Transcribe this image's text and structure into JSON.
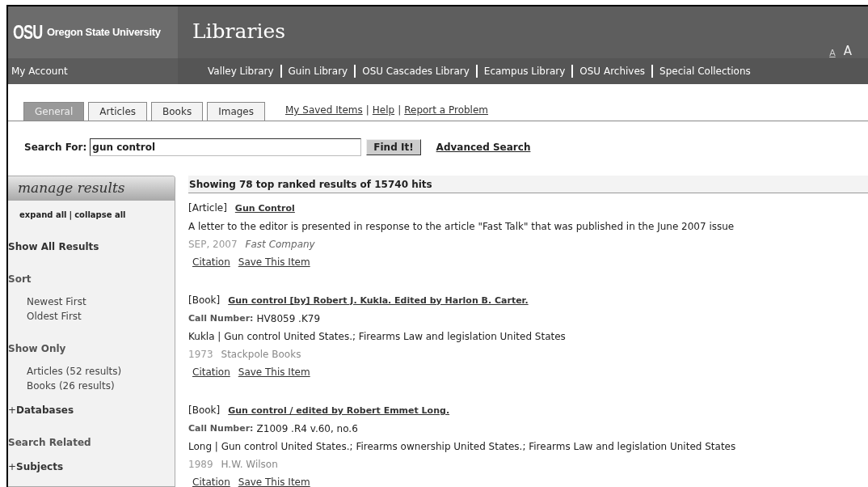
{
  "header": {
    "logo_mark": "OSU",
    "logo_text": "Oregon State University",
    "title": "Libraries",
    "text_sizes": [
      {
        "label": "A",
        "kind": "small",
        "selected": true
      },
      {
        "label": "A",
        "kind": "medium",
        "selected": false
      }
    ]
  },
  "nav": {
    "account": "My Account",
    "libraries": [
      "Valley Library",
      "Guin Library",
      "OSU Cascades Library",
      "Ecampus Library",
      "OSU Archives",
      "Special Collections"
    ]
  },
  "tabs": [
    {
      "label": "General",
      "selected": true
    },
    {
      "label": "Articles",
      "selected": false
    },
    {
      "label": "Books",
      "selected": false
    },
    {
      "label": "Images",
      "selected": false
    }
  ],
  "links": {
    "items": [
      "My Saved Items",
      "Help",
      "Report a Problem"
    ],
    "separator": "|"
  },
  "search": {
    "label": "Search For:",
    "value": "gun control",
    "button": "Find It!",
    "advanced": "Advanced Search"
  },
  "sidebar": {
    "title": "manage results",
    "expand": "expand all",
    "separator": "|",
    "collapse": "collapse all",
    "show_all": "Show All Results",
    "sections": [
      {
        "kind": "list",
        "title": "Sort",
        "items": [
          "Newest First",
          "Oldest First"
        ]
      },
      {
        "kind": "list",
        "title": "Show Only",
        "items": [
          "Articles (52 results)",
          "Books (26 results)"
        ]
      },
      {
        "kind": "expander",
        "sign": "+",
        "title": "Databases"
      },
      {
        "kind": "list",
        "title": "Search Related"
      },
      {
        "kind": "expander",
        "sign": "+",
        "title": "Subjects"
      }
    ]
  },
  "results": {
    "summary": "Showing 78 top ranked results of 15740 hits",
    "items": [
      {
        "type": "[Article]",
        "title": "Gun Control",
        "description": "A letter to the editor is presented in response to the article \"Fast Talk\" that was published in the June 2007 issue",
        "date": "SEP, 2007",
        "source": "Fast Company",
        "source_italic": true,
        "actions": [
          "Citation",
          "Save This Item"
        ]
      },
      {
        "type": "[Book]",
        "title": "Gun control [by] Robert J. Kukla. Edited by Harlon B. Carter.",
        "call_label": "Call Number:",
        "call_number": "HV8059 .K79",
        "description": "Kukla | Gun control United States.; Firearms Law and legislation United States",
        "date": "1973",
        "source": "Stackpole Books",
        "source_italic": false,
        "actions": [
          "Citation",
          "Save This Item"
        ]
      },
      {
        "type": "[Book]",
        "title": "Gun control / edited by Robert Emmet Long.",
        "call_label": "Call Number:",
        "call_number": "Z1009 .R4 v.60, no.6",
        "description": "Long | Gun control United States.; Firearms ownership United States.; Firearms Law and legislation United States",
        "date": "1989",
        "source": "H.W. Wilson",
        "source_italic": false,
        "actions": [
          "Citation",
          "Save This Item"
        ]
      }
    ]
  }
}
